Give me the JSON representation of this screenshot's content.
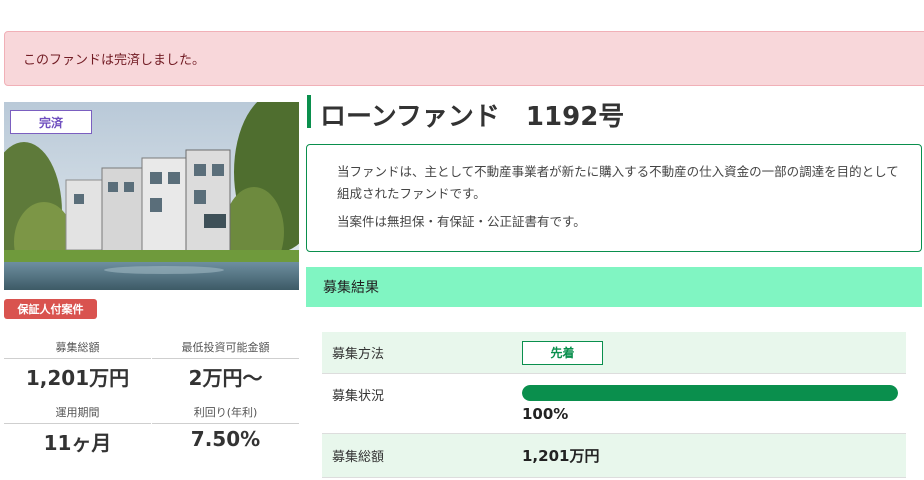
{
  "alert": {
    "message": "このファンドは完済しました。"
  },
  "fund": {
    "status_tag": "完済",
    "guarantee_badge": "保証人付案件",
    "title": "ローンファンド　1192号",
    "description": [
      "当ファンドは、主として不動産事業者が新たに購入する不動産の仕入資金の一部の調達を目的として組成されたファンドです。",
      "当案件は無担保・有保証・公正証書有です。"
    ]
  },
  "stats": [
    {
      "label": "募集総額",
      "value": "1,201万円"
    },
    {
      "label": "最低投資可能金額",
      "value": "2万円～"
    },
    {
      "label": "運用期間",
      "value": "11ヶ月"
    },
    {
      "label": "利回り(年利)",
      "value": "7.50%"
    }
  ],
  "results": {
    "heading": "募集結果",
    "method_label": "募集方法",
    "method_value": "先着",
    "status_label": "募集状況",
    "progress_percent": 100,
    "progress_text": "100%",
    "total_label": "募集総額",
    "total_value": "1,201万円"
  },
  "colors": {
    "accent_green": "#0a8f4d",
    "section_green": "#80f5c2",
    "alert_bg": "#f8d7da",
    "badge_red": "#d9534f",
    "status_purple": "#6f4fbf"
  }
}
